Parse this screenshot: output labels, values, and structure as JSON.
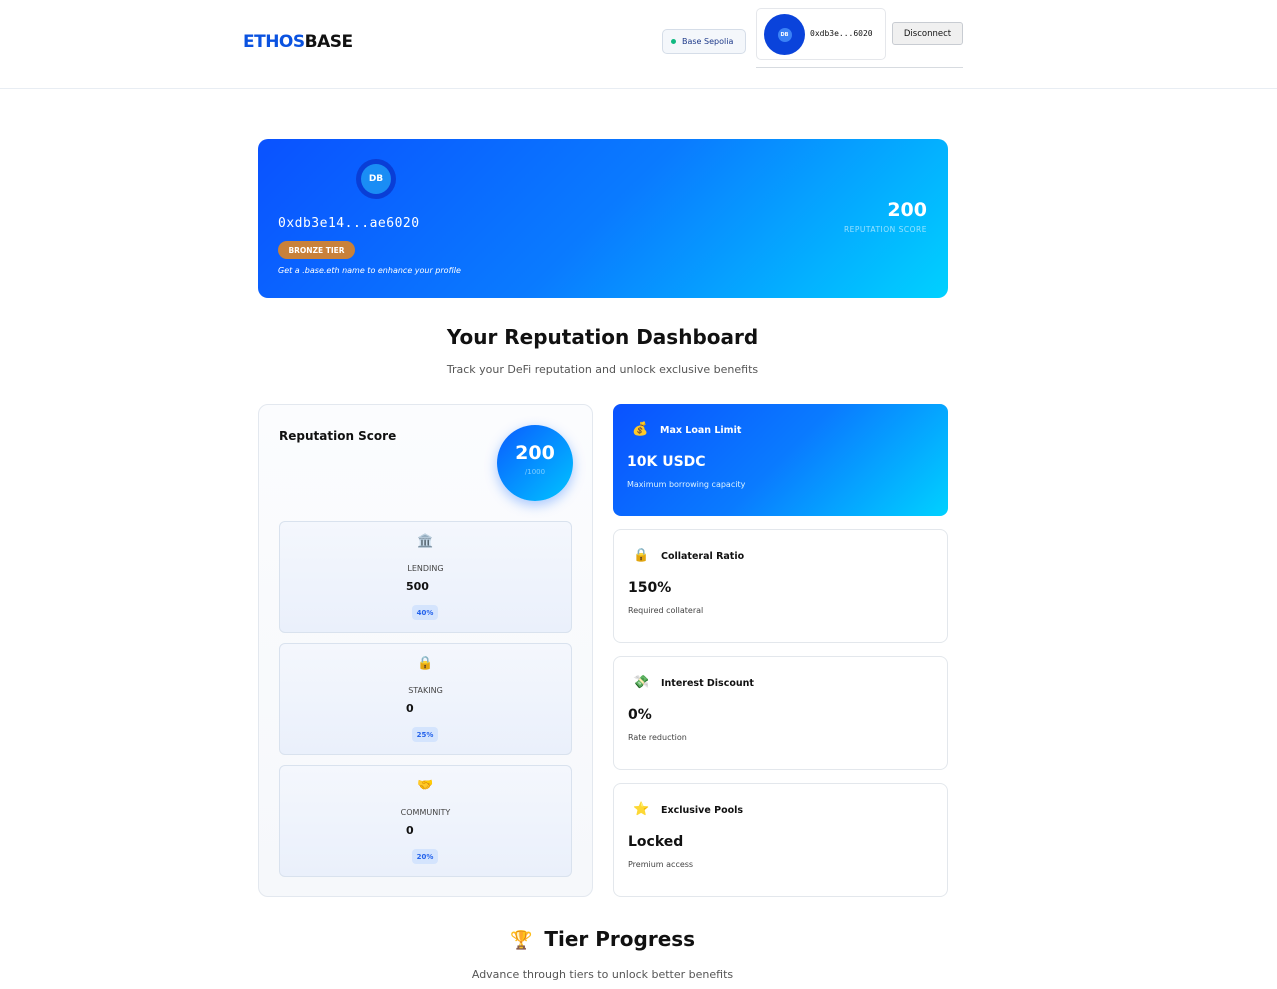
{
  "header": {
    "logo_part1": "ETHOS",
    "logo_part2": "BASE",
    "network": "Base Sepolia",
    "wallet_avatar": "DB",
    "wallet_address": "0xdb3e...6020",
    "disconnect_label": "Disconnect"
  },
  "profile": {
    "avatar": "DB",
    "address": "0xdb3e14...ae6020",
    "tier": "BRONZE TIER",
    "hint": "Get a .base.eth name to enhance your profile",
    "score": "200",
    "score_label": "REPUTATION SCORE"
  },
  "dashboard": {
    "title": "Your Reputation Dashboard",
    "subtitle": "Track your DeFi reputation and unlock exclusive benefits"
  },
  "reputation": {
    "title": "Reputation Score",
    "score": "200",
    "score_unit": "/1000",
    "categories": [
      {
        "icon": "🏛️",
        "label": "LENDING",
        "value": "500",
        "weight": "40%"
      },
      {
        "icon": "🔒",
        "label": "STAKING",
        "value": "0",
        "weight": "25%"
      },
      {
        "icon": "🤝",
        "label": "COMMUNITY",
        "value": "0",
        "weight": "20%"
      }
    ]
  },
  "benefits": [
    {
      "icon": "💰",
      "title": "Max Loan Limit",
      "value": "10K USDC",
      "desc": "Maximum borrowing capacity"
    },
    {
      "icon": "🔒",
      "title": "Collateral Ratio",
      "value": "150%",
      "desc": "Required collateral"
    },
    {
      "icon": "💸",
      "title": "Interest Discount",
      "value": "0%",
      "desc": "Rate reduction"
    },
    {
      "icon": "⭐",
      "title": "Exclusive Pools",
      "value": "Locked",
      "desc": "Premium access"
    }
  ],
  "tier_progress": {
    "icon": "🏆",
    "title": "Tier Progress",
    "subtitle": "Advance through tiers to unlock better benefits"
  },
  "colors": {
    "primary": "#0a52ff",
    "accent": "#00d1ff",
    "bronze": "#c9813a"
  }
}
